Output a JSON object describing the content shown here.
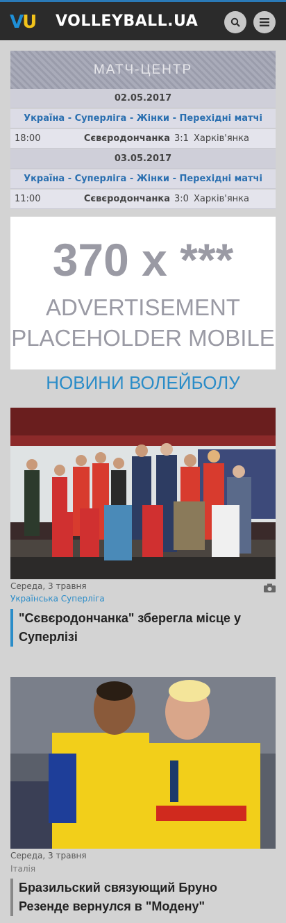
{
  "header": {
    "logo_v": "V",
    "logo_u": "U",
    "site_name": "VOLLEYBALL.UA",
    "icons": [
      "search-icon",
      "menu-icon"
    ]
  },
  "match_center": {
    "title": "МАТЧ-ЦЕНТР",
    "days": [
      {
        "date": "02.05.2017",
        "league": "Україна - Суперліга - Жінки - Перехідні матчі",
        "games": [
          {
            "time": "18:00",
            "home": "Сєвєродончанка",
            "score": "3:1",
            "away": "Харків'янка"
          }
        ]
      },
      {
        "date": "03.05.2017",
        "league": "Україна - Суперліга - Жінки - Перехідні матчі",
        "games": [
          {
            "time": "11:00",
            "home": "Сєвєродончанка",
            "score": "3:0",
            "away": "Харків'янка"
          }
        ]
      }
    ]
  },
  "ad": {
    "size": "370 x ***",
    "line1": "ADVERTISEMENT",
    "line2": "PLACEHOLDER MOBILE"
  },
  "news": {
    "section_title": "НОВИНИ ВОЛЕЙБОЛУ",
    "items": [
      {
        "date": "Середа, 3 травня",
        "category": "Українська Суперліга",
        "title": "\"Сєвєродончанка\" зберегла місце у Суперлізі",
        "has_photo_icon": true
      },
      {
        "date": "Середа, 3 травня",
        "category": "Італія",
        "title": "Бразильский связующий Бруно Резенде вернулся в \"Модену\""
      }
    ]
  },
  "colors": {
    "accent": "#2a8cc8",
    "topbar": "#2b2b2b",
    "background": "#d3d3d3"
  }
}
